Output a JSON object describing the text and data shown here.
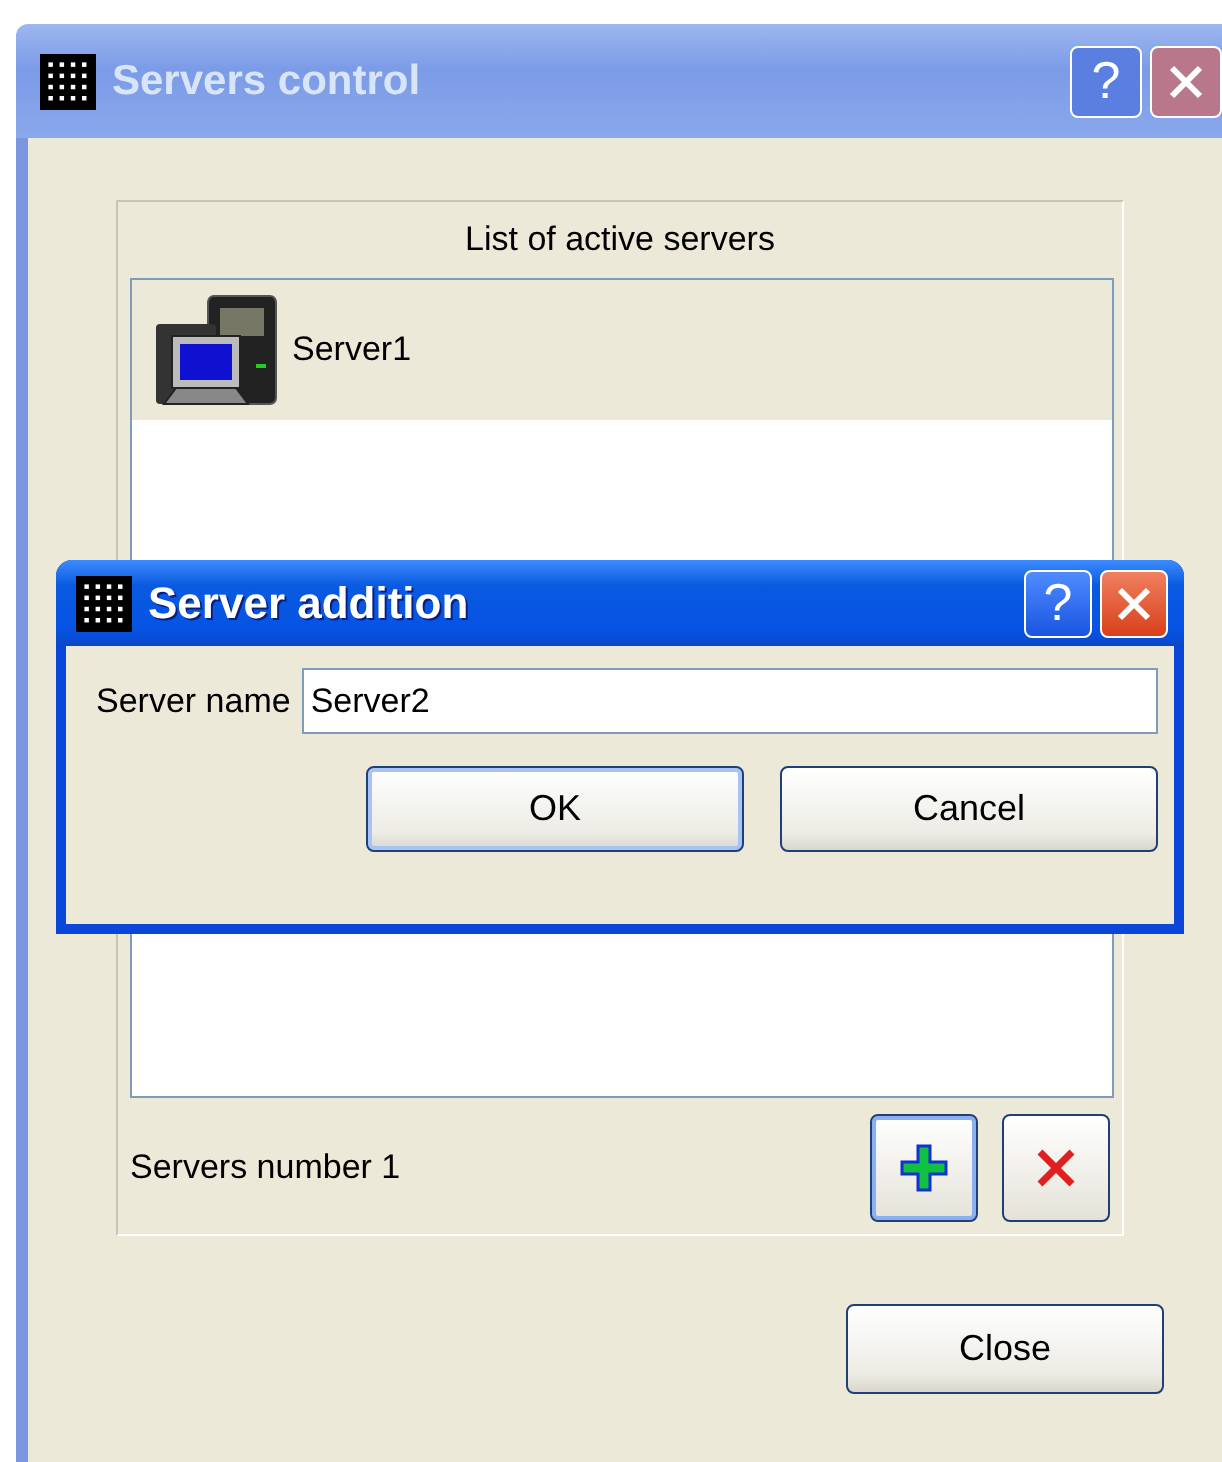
{
  "window": {
    "title": "Servers control",
    "help": "?",
    "active": false
  },
  "server_list": {
    "heading": "List of active servers",
    "items": [
      {
        "name": "Server1",
        "selected": true
      }
    ],
    "count_label": "Servers number 1",
    "tools": [
      {
        "kind": "add",
        "highlighted": true
      },
      {
        "kind": "remove",
        "highlighted": false
      }
    ]
  },
  "buttons": [
    {
      "label": "Close",
      "default": false
    }
  ],
  "dialog": {
    "title": "Server addition",
    "help": "?",
    "active": true,
    "field_label": "Server name",
    "field_value": "Server2",
    "buttons": [
      {
        "label": "OK",
        "default": true
      },
      {
        "label": "Cancel",
        "default": false
      }
    ]
  }
}
